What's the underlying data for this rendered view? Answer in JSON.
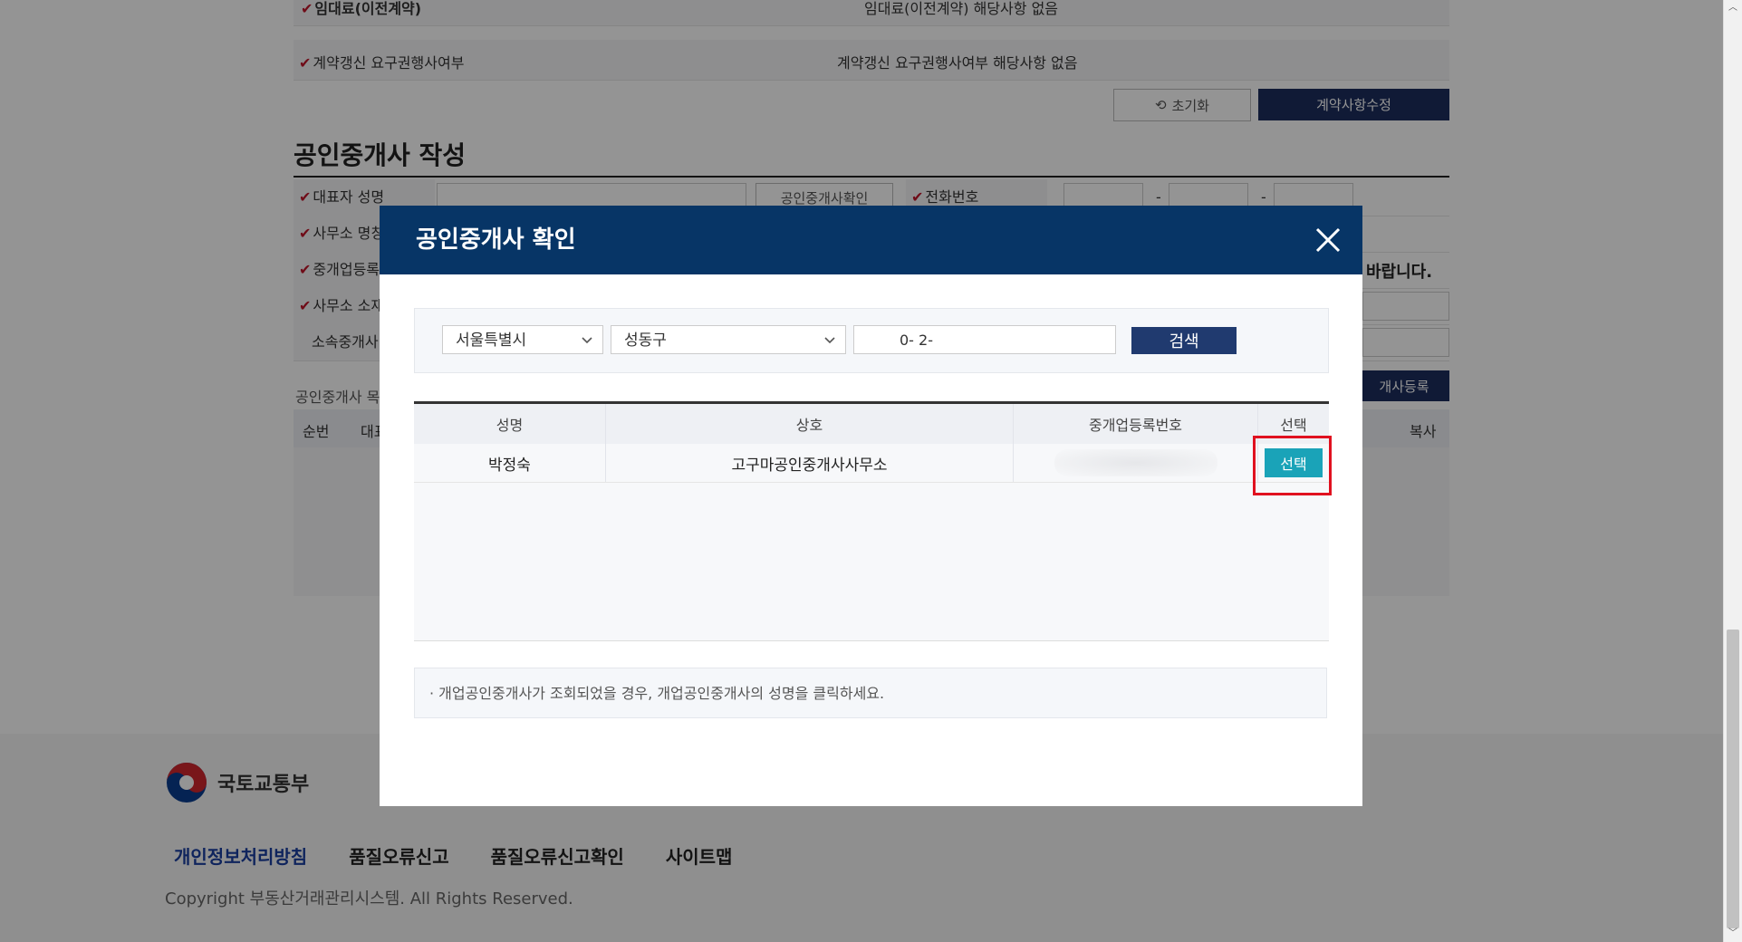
{
  "background_page": {
    "contract": {
      "row1_label": "임대료(이전계약)",
      "row1_value": "임대료(이전계약) 해당사항 없음",
      "row2_label": "계약갱신 요구권행사여부",
      "row2_value": "계약갱신 요구권행사여부 해당사항 없음",
      "reset_label": "초기화",
      "modify_label": "계약사항수정"
    },
    "broker_section": {
      "title": "공인중개사 작성",
      "rep_name_label": "대표자 성명",
      "confirm_button": "공인중개사확인",
      "phone_label": "전화번호",
      "phone_sep1": "-",
      "phone_sep2": "-",
      "office_name_label": "사무소 명칭",
      "reg_no_label": "중개업등록번호",
      "notice_tail": "바랍니다.",
      "office_addr_label": "사무소 소재지",
      "affiliated_label": "소속중개사",
      "list_label": "공인중개사 목록",
      "register_button_tail": "개사등록",
      "col_no": "순번",
      "col_rep": "대표",
      "col_copy": "복사"
    },
    "footer": {
      "logo_text": "국토교통부",
      "links": [
        "개인정보처리방침",
        "품질오류신고",
        "품질오류신고확인",
        "사이트맵"
      ],
      "copyright": "Copyright 부동산거래관리시스템. All Rights Reserved."
    }
  },
  "modal": {
    "title": "공인중개사 확인",
    "search": {
      "sido": "서울특별시",
      "sigungu": "성동구",
      "reg_no_value": "0-     2-",
      "button": "검색"
    },
    "table": {
      "headers": [
        "성명",
        "상호",
        "중개업등록번호",
        "선택"
      ],
      "rows": [
        {
          "name": "박정숙",
          "company": "고구마공인중개사사무소",
          "reg_no": "",
          "select_label": "선택"
        }
      ]
    },
    "note": "· 개업공인중개사가 조회되었을 경우, 개업공인중개사의 성명을 클릭하세요."
  },
  "colors": {
    "modal_header": "#073566",
    "search_button": "#203a6f",
    "select_button": "#1aa3b8",
    "highlight": "#e0111f",
    "required_mark": "#c0152a"
  }
}
